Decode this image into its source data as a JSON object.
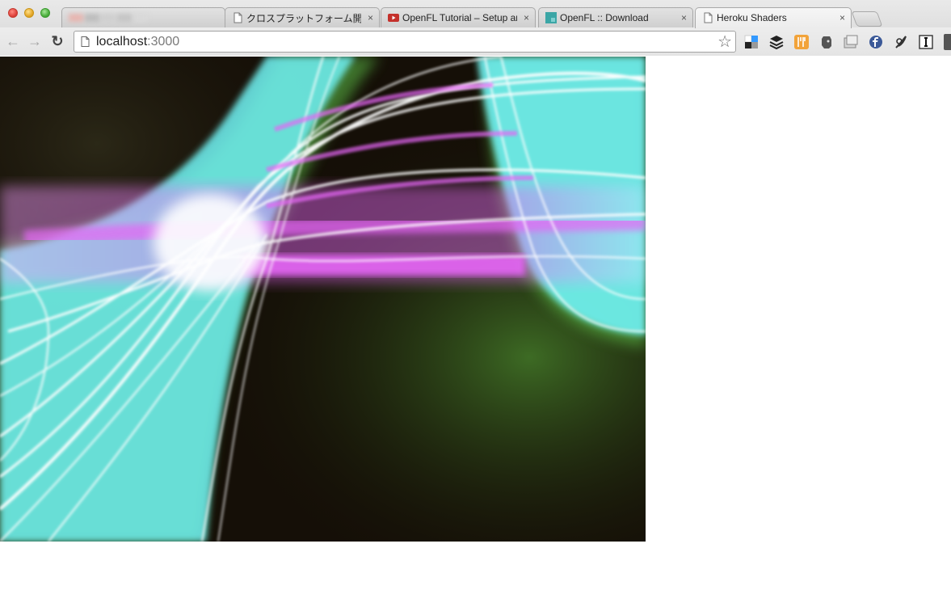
{
  "window": {
    "buttons": [
      "close",
      "minimize",
      "zoom"
    ]
  },
  "tabs": [
    {
      "title": "",
      "favicon": "blurred-favicon",
      "close": "×",
      "active": false
    },
    {
      "title": "クロスプラットフォーム開発",
      "favicon": "page-icon",
      "close": "×",
      "active": false
    },
    {
      "title": "OpenFL Tutorial – Setup and",
      "favicon": "youtube-icon",
      "close": "×",
      "active": false
    },
    {
      "title": "OpenFL :: Download",
      "favicon": "openfl-icon",
      "close": "×",
      "active": false
    },
    {
      "title": "Heroku Shaders",
      "favicon": "page-icon",
      "close": "×",
      "active": true
    }
  ],
  "toolbar": {
    "back": "←",
    "forward": "→",
    "reload": "↻",
    "url_host": "localhost",
    "url_port": ":3000",
    "bookmark_star": "☆"
  },
  "extensions": [
    "delicious-icon",
    "buffer-icon",
    "restaurant-icon",
    "evernote-icon",
    "window-icon",
    "facebook-icon",
    "feather-icon",
    "instapaper-icon"
  ],
  "colors": {
    "shader_cyan": "#6ff2f4",
    "shader_magenta": "#e566f5",
    "shader_white": "#ffffff",
    "shader_green": "#5fc24a",
    "shader_dark": "#150f07"
  }
}
